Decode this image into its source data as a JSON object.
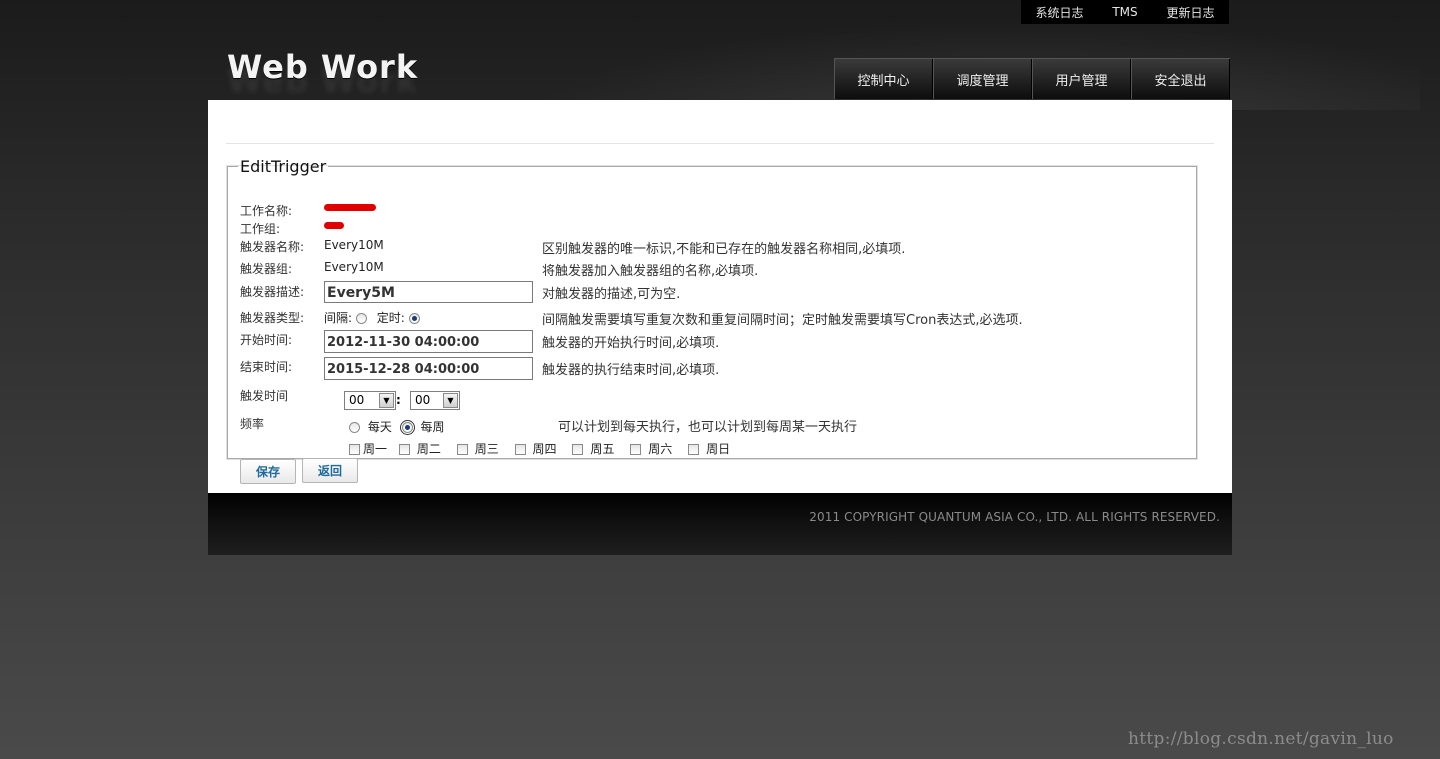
{
  "topbar": {
    "items": [
      "系统日志",
      "TMS",
      "更新日志"
    ]
  },
  "header": {
    "logo": "Web Work"
  },
  "nav": {
    "items": [
      "控制中心",
      "调度管理",
      "用户管理",
      "安全退出"
    ]
  },
  "form": {
    "legend": "EditTrigger",
    "labels": {
      "job_name": "工作名称:",
      "job_group": "工作组:",
      "trigger_name": "触发器名称:",
      "trigger_group": "触发器组:",
      "trigger_desc": "触发器描述:",
      "trigger_type": "触发器类型:",
      "start_time": "开始时间:",
      "end_time": "结束时间:",
      "fire_time": "触发时间",
      "frequency": "频率"
    },
    "values": {
      "trigger_name": "Every10M",
      "trigger_group": "Every10M",
      "trigger_desc": "Every5M",
      "start_time": "2012-11-30 04:00:00",
      "end_time": "2015-12-28 04:00:00",
      "hour": "00",
      "minute": "00",
      "time_sep": ":"
    },
    "type_options": {
      "interval": "间隔:",
      "scheduled": "定时:",
      "selected": "定时"
    },
    "freq_options": {
      "daily": "每天",
      "weekly": "每周",
      "selected": "每周"
    },
    "weekdays": [
      "周一",
      "周二",
      "周三",
      "周四",
      "周五",
      "周六",
      "周日"
    ],
    "hints": {
      "trigger_name": "区别触发器的唯一标识,不能和已存在的触发器名称相同,必填项.",
      "trigger_group": "将触发器加入触发器组的名称,必填项.",
      "trigger_desc": "对触发器的描述,可为空.",
      "trigger_type": "间隔触发需要填写重复次数和重复间隔时间；定时触发需要填写Cron表达式,必选项.",
      "start_time": "触发器的开始执行时间,必填项.",
      "end_time": "触发器的执行结束时间,必填项.",
      "frequency": "可以计划到每天执行，也可以计划到每周某一天执行"
    },
    "buttons": {
      "save": "保存",
      "back": "返回"
    }
  },
  "footer": {
    "copyright": "2011 COPYRIGHT QUANTUM ASIA CO., LTD. ALL RIGHTS RESERVED."
  },
  "watermark": "http://blog.csdn.net/gavin_luo",
  "colors": {
    "redaction": "#e00000",
    "button_text": "#1f6a9a"
  }
}
